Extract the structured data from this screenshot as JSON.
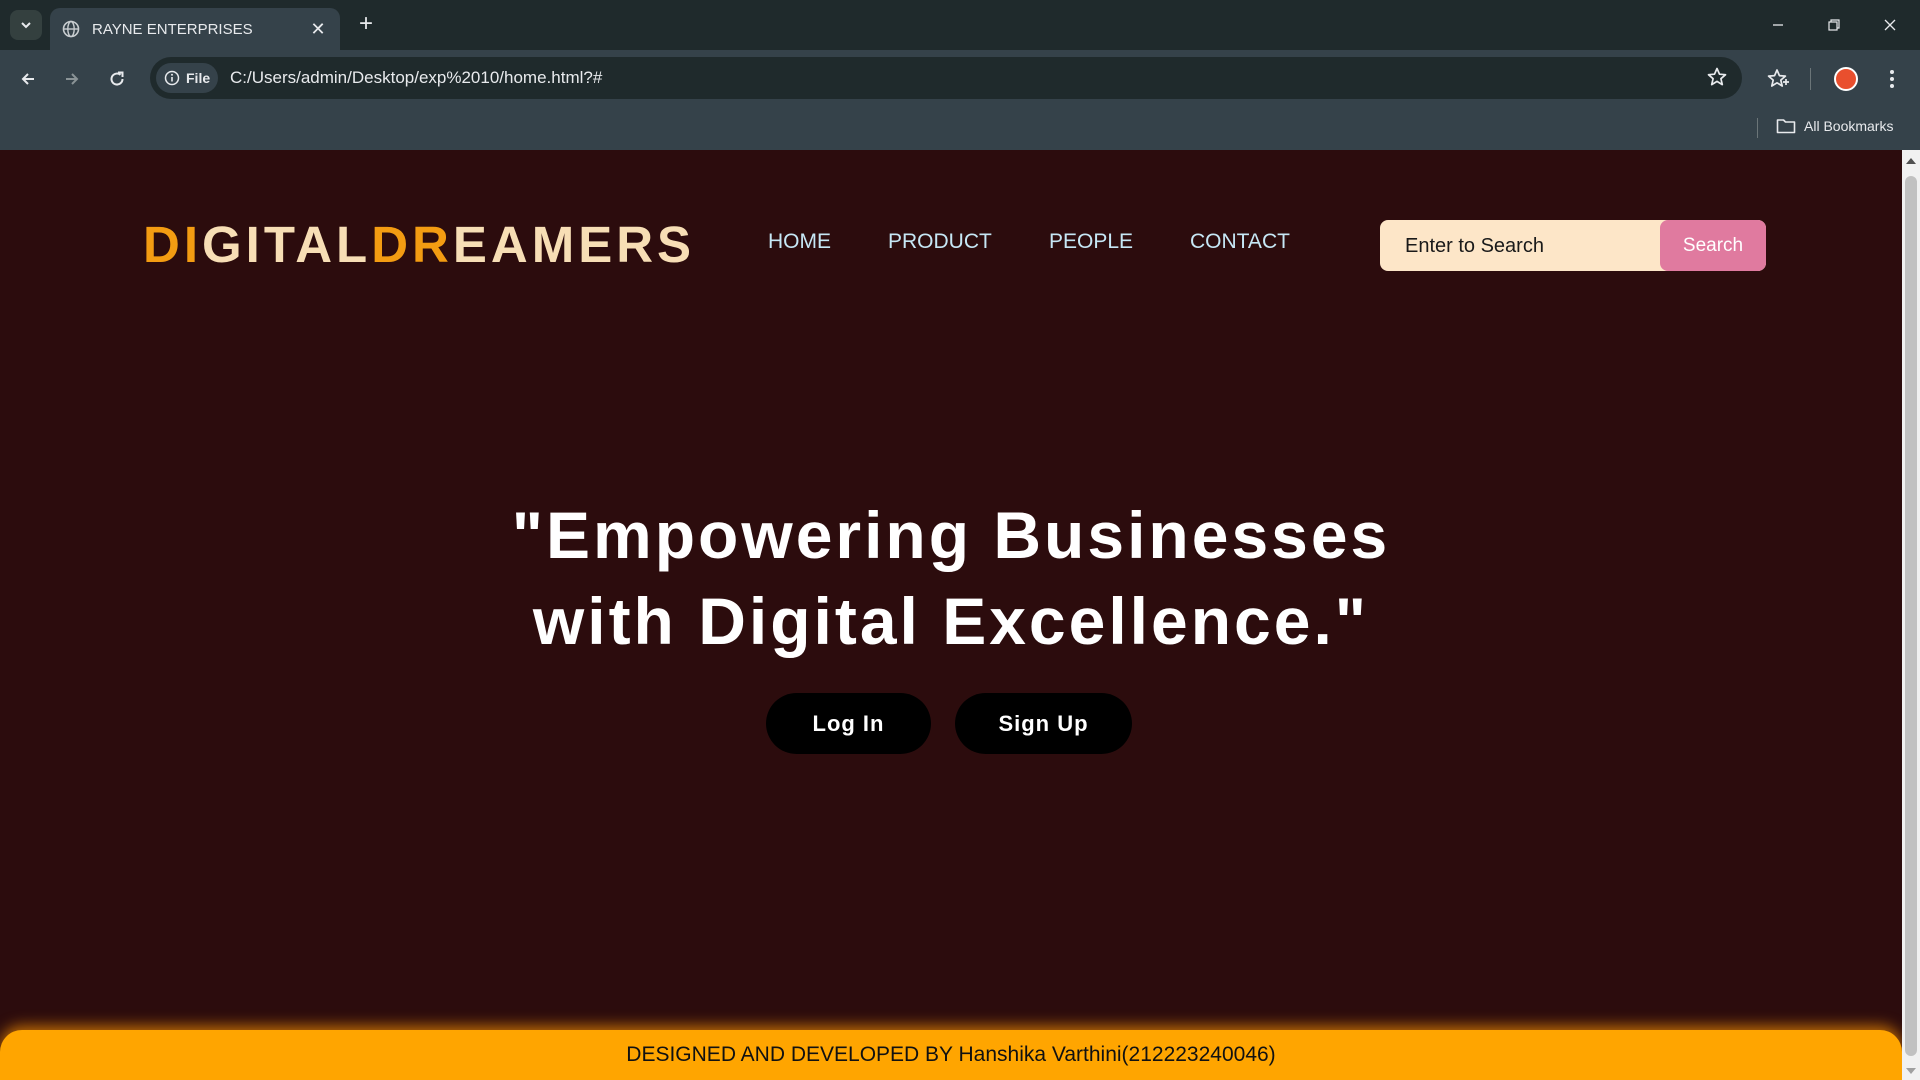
{
  "browser": {
    "tab_title": "RAYNE ENTERPRISES",
    "tab_close": "✕",
    "new_tab": "+",
    "chip_label": "File",
    "url": "C:/Users/admin/Desktop/exp%2010/home.html?#",
    "all_bookmarks": "All Bookmarks"
  },
  "page": {
    "logo": {
      "part1": "DI",
      "part2": "GITAL",
      "part3": "DR",
      "part4": "EAMERS"
    },
    "nav": [
      "HOME",
      "PRODUCT",
      "PEOPLE",
      "CONTACT"
    ],
    "search": {
      "placeholder": "Enter to Search",
      "button": "Search"
    },
    "headline_line1": "\"Empowering Businesses",
    "headline_line2": "with Digital Excellence.\"",
    "login": "Log In",
    "signup": "Sign Up",
    "footer": "DESIGNED AND DEVELOPED BY Hanshika Varthini(212223240046)"
  },
  "colors": {
    "page_bg": "#2c0c0d",
    "logo_orange": "#f39c12",
    "logo_cream": "#f7deb5",
    "nav_text": "#c6e7f5",
    "search_bg": "#fde6c8",
    "search_button": "#e07a9f",
    "footer_bg": "#ffa500"
  },
  "icons": [
    "tab-search-icon",
    "globe-icon",
    "back-icon",
    "forward-icon",
    "reload-icon",
    "info-icon",
    "bookmark-star-icon",
    "bookmarks-icon",
    "profile-avatar",
    "menu-icon",
    "folder-icon",
    "minimize-icon",
    "restore-icon",
    "close-window-icon"
  ]
}
